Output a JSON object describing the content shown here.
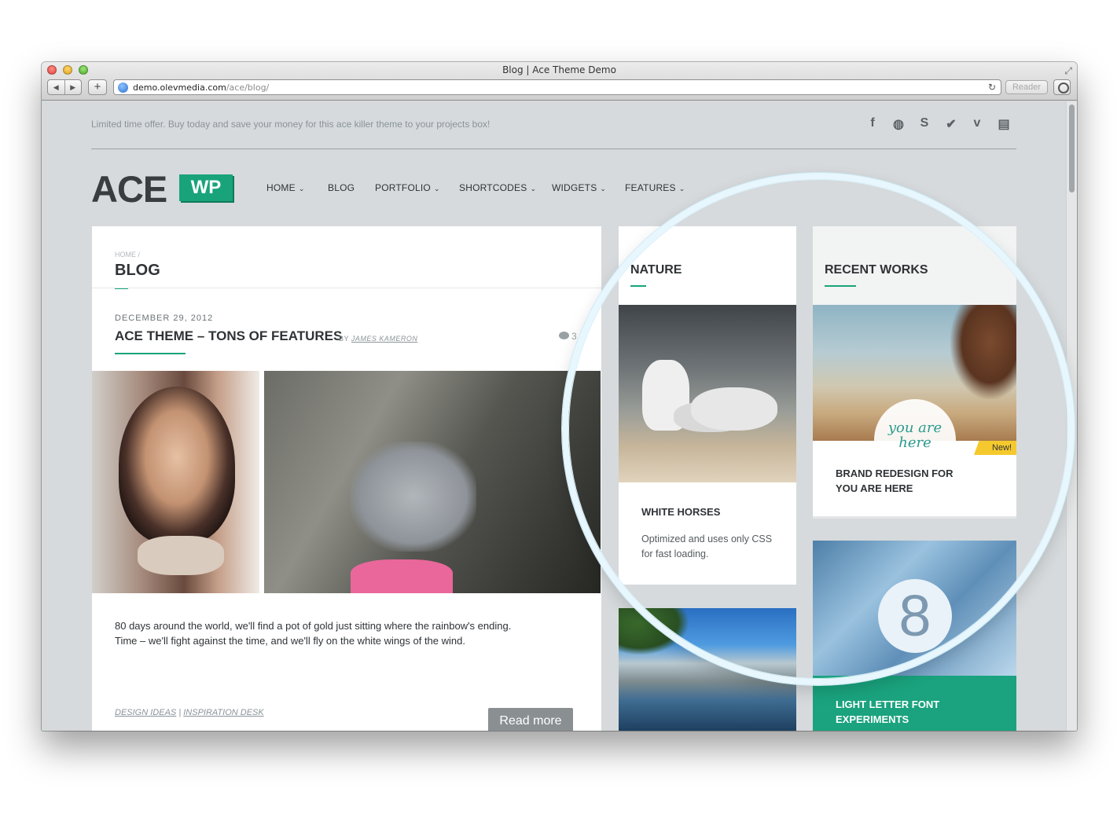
{
  "window": {
    "title": "Blog | Ace Theme Demo",
    "url_host": "demo.olevmedia.com",
    "url_path": "/ace/blog/",
    "reader_label": "Reader"
  },
  "topbar": {
    "offer_text": "Limited time offer. Buy today and save your money for this ace killer theme to your projects box!",
    "social": [
      "f",
      "◍",
      "S",
      "✔",
      "v",
      "▤"
    ]
  },
  "logo": {
    "ace": "ACE",
    "wp": "WP"
  },
  "menu": [
    "HOME",
    "BLOG",
    "PORTFOLIO",
    "SHORTCODES",
    "WIDGETS",
    "FEATURES"
  ],
  "post": {
    "breadcrumb": "HOME /",
    "page_title": "BLOG",
    "date": "DECEMBER 29, 2012",
    "title": "ACE THEME – TONS OF FEATURES",
    "by": "BY",
    "author": "JAMES KAMERON",
    "comments": "3",
    "excerpt": "80 days around the world, we'll find a pot of gold just sitting where the rainbow's ending. Time – we'll fight against the time, and we'll fly on the white wings of the wind.",
    "tags": [
      "DESIGN IDEAS",
      "INSPIRATION DESK"
    ],
    "tag_separator": "|",
    "read_more": "Read more"
  },
  "nature": {
    "title": "NATURE",
    "caption": "WHITE HORSES",
    "desc": "Optimized and uses only CSS for fast loading."
  },
  "recent_works": {
    "title": "RECENT WORKS",
    "badge": "New!",
    "item1": "BRAND REDESIGN FOR YOU ARE HERE",
    "pin_text": "you are here",
    "ice_digit": "8",
    "item2": "LIGHT LETTER FONT EXPERIMENTS"
  },
  "colors": {
    "accent": "#19a37b",
    "badge": "#f5c92e",
    "page_bg": "#d6dadc"
  }
}
